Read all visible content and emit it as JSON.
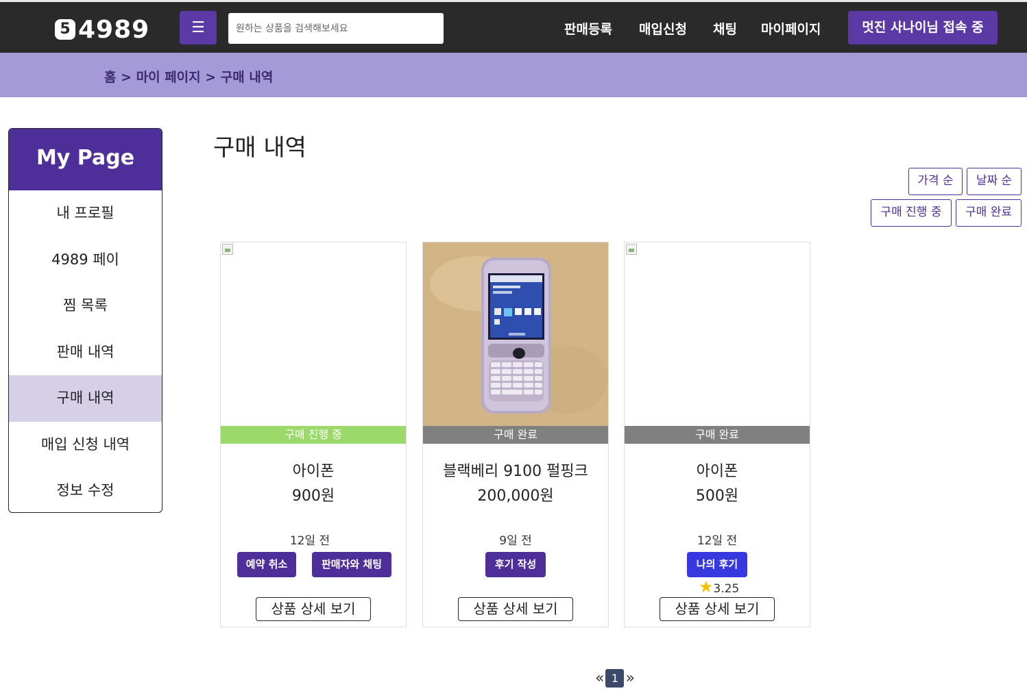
{
  "header": {
    "logo_mark": "5",
    "logo_text": "4989",
    "menu_icon": "☰",
    "search_placeholder": "원하는 상품을 검색해보세요",
    "nav": [
      "판매등록",
      "매입신청",
      "채팅",
      "마이페이지"
    ],
    "user_button": "멋진 사나이님 접속 중"
  },
  "breadcrumb": "홈 > 마이 페이지 > 구매 내역",
  "sidebar": {
    "title": "My Page",
    "items": [
      "내 프로필",
      "4989 페이",
      "찜 목록",
      "판매 내역",
      "구매 내역",
      "매입 신청 내역",
      "정보 수정"
    ],
    "active_index": 4
  },
  "main": {
    "title": "구매 내역",
    "sort_buttons": [
      "가격 순",
      "날짜 순"
    ],
    "filter_buttons": [
      "구매 진행 중",
      "구매 완료"
    ]
  },
  "cards": [
    {
      "status": "구매 진행 중",
      "status_color": "#9ad96a",
      "name": "아이폰",
      "price": "900원",
      "date": "12일 전",
      "actions": [
        "예약 취소",
        "판매자와 채팅"
      ],
      "detail": "상품 상세 보기",
      "image": "broken"
    },
    {
      "status": "구매 완료",
      "status_color": "#808080",
      "name": "블랙베리 9100 펄핑크",
      "price": "200,000원",
      "date": "9일 전",
      "actions": [
        "후기 작성"
      ],
      "detail": "상품 상세 보기",
      "image": "phone-photo"
    },
    {
      "status": "구매 완료",
      "status_color": "#808080",
      "name": "아이폰",
      "price": "500원",
      "date": "12일 전",
      "actions": [
        "나의 후기"
      ],
      "rating": "3.25",
      "detail": "상품 상세 보기",
      "image": "broken"
    }
  ],
  "pagination": {
    "prev": "«",
    "current": "1",
    "next": "»"
  },
  "colors": {
    "primary": "#4e2e99",
    "header_bg": "#2a2a2a",
    "crumb_bg": "#a59ad8",
    "review_blue": "#3838e0"
  }
}
